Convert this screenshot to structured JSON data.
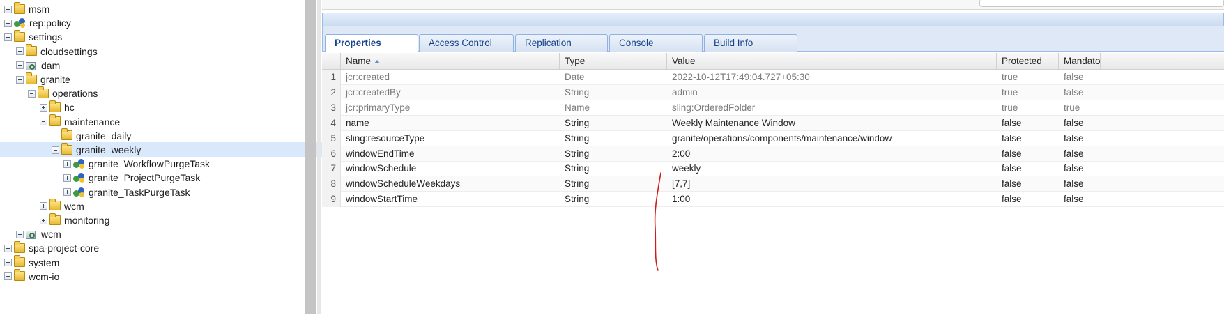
{
  "tree": {
    "items": [
      {
        "label": "msm",
        "icon": "folder-icon",
        "toggle": "plus",
        "depth": 0
      },
      {
        "label": "rep:policy",
        "icon": "policy-icon",
        "toggle": "plus",
        "depth": 0
      },
      {
        "label": "settings",
        "icon": "folder-icon",
        "toggle": "minus",
        "depth": 0
      },
      {
        "label": "cloudsettings",
        "icon": "folder-icon",
        "toggle": "plus",
        "depth": 1
      },
      {
        "label": "dam",
        "icon": "gear-folder-icon",
        "toggle": "plus",
        "depth": 1
      },
      {
        "label": "granite",
        "icon": "folder-icon",
        "toggle": "minus",
        "depth": 1
      },
      {
        "label": "operations",
        "icon": "folder-icon",
        "toggle": "minus",
        "depth": 2
      },
      {
        "label": "hc",
        "icon": "folder-icon",
        "toggle": "plus",
        "depth": 3
      },
      {
        "label": "maintenance",
        "icon": "folder-icon",
        "toggle": "minus",
        "depth": 3
      },
      {
        "label": "granite_daily",
        "icon": "folder-icon",
        "toggle": "none",
        "depth": 4
      },
      {
        "label": "granite_weekly",
        "icon": "folder-icon",
        "toggle": "minus",
        "depth": 4,
        "selected": true
      },
      {
        "label": "granite_WorkflowPurgeTask",
        "icon": "policy-icon",
        "toggle": "plus",
        "depth": 5
      },
      {
        "label": "granite_ProjectPurgeTask",
        "icon": "policy-icon",
        "toggle": "plus",
        "depth": 5
      },
      {
        "label": "granite_TaskPurgeTask",
        "icon": "policy-icon",
        "toggle": "plus",
        "depth": 5
      },
      {
        "label": "wcm",
        "icon": "folder-icon",
        "toggle": "plus",
        "depth": 3
      },
      {
        "label": "monitoring",
        "icon": "folder-icon",
        "toggle": "plus",
        "depth": 3
      },
      {
        "label": "wcm",
        "icon": "gear-folder-icon",
        "toggle": "plus",
        "depth": 1
      },
      {
        "label": "spa-project-core",
        "icon": "folder-icon",
        "toggle": "plus",
        "depth": 0
      },
      {
        "label": "system",
        "icon": "folder-icon",
        "toggle": "plus",
        "depth": 0
      },
      {
        "label": "wcm-io",
        "icon": "folder-icon",
        "toggle": "plus",
        "depth": 0
      }
    ]
  },
  "tabs": [
    {
      "label": "Properties",
      "active": true
    },
    {
      "label": "Access Control",
      "active": false
    },
    {
      "label": "Replication",
      "active": false
    },
    {
      "label": "Console",
      "active": false
    },
    {
      "label": "Build Info",
      "active": false
    }
  ],
  "grid": {
    "columns": [
      "Name",
      "Type",
      "Value",
      "Protected",
      "Mandatory"
    ],
    "sort_column": "Name",
    "sort_direction": "ascending",
    "rows": [
      {
        "num": "1",
        "name": "jcr:created",
        "type": "Date",
        "value": "2022-10-12T17:49:04.727+05:30",
        "protected": "true",
        "mandatory": "false"
      },
      {
        "num": "2",
        "name": "jcr:createdBy",
        "type": "String",
        "value": "admin",
        "protected": "true",
        "mandatory": "false"
      },
      {
        "num": "3",
        "name": "jcr:primaryType",
        "type": "Name",
        "value": "sling:OrderedFolder",
        "protected": "true",
        "mandatory": "true"
      },
      {
        "num": "4",
        "name": "name",
        "type": "String",
        "value": "Weekly Maintenance Window",
        "protected": "false",
        "mandatory": "false"
      },
      {
        "num": "5",
        "name": "sling:resourceType",
        "type": "String",
        "value": "granite/operations/components/maintenance/window",
        "protected": "false",
        "mandatory": "false"
      },
      {
        "num": "6",
        "name": "windowEndTime",
        "type": "String",
        "value": "2:00",
        "protected": "false",
        "mandatory": "false"
      },
      {
        "num": "7",
        "name": "windowSchedule",
        "type": "String",
        "value": "weekly",
        "protected": "false",
        "mandatory": "false"
      },
      {
        "num": "8",
        "name": "windowScheduleWeekdays",
        "type": "String",
        "value": "[7,7]",
        "protected": "false",
        "mandatory": "false"
      },
      {
        "num": "9",
        "name": "windowStartTime",
        "type": "String",
        "value": "1:00",
        "protected": "false",
        "mandatory": "false"
      }
    ]
  },
  "colors": {
    "selection": "#d9e9fb",
    "tab_text": "#15428b",
    "panel_border": "#99bbe8",
    "annotation": "#d11a1a"
  }
}
